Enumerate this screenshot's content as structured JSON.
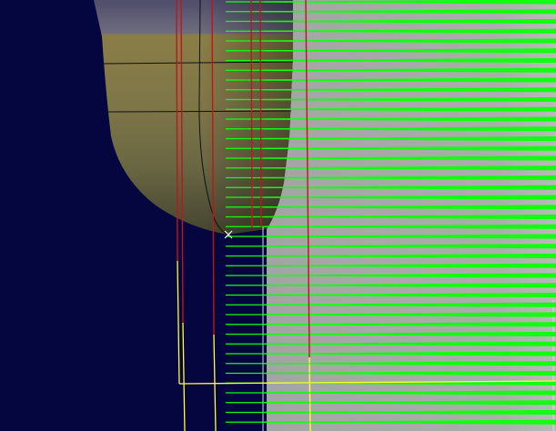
{
  "viewport": {
    "background": "#05053f",
    "cursor": "crosshair-marker"
  },
  "colors": {
    "part_top": "#5c5b72",
    "part_band": "#83794a",
    "part_lower": "#6b6946",
    "part_outline": "#111111",
    "stock_surface": "#a6a6a6",
    "toolpath_passes": "#12ff12",
    "tool_guides": "#c0151c",
    "boundary_lines": "#ffff33",
    "secondary_edge": "#d9d9d9",
    "cursor": "#ffffff"
  },
  "icons": [
    "crosshair-icon"
  ]
}
